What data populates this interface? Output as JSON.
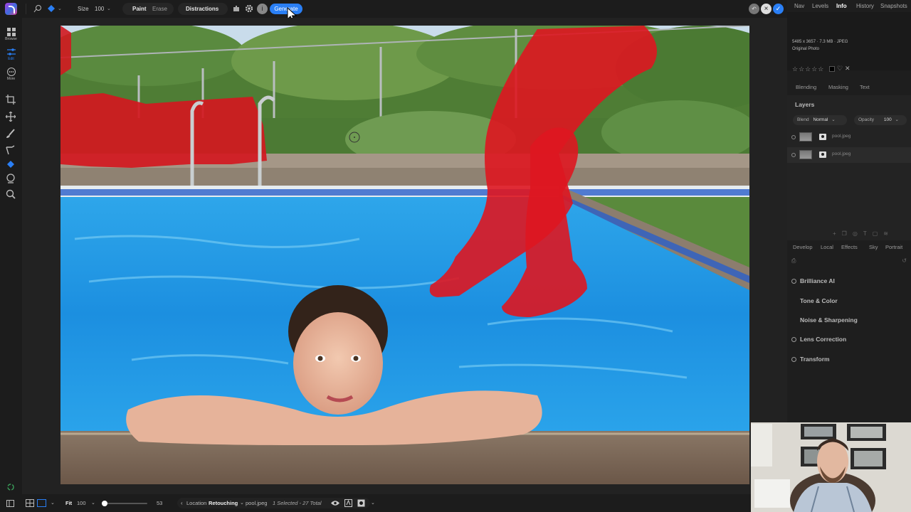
{
  "toolbar": {
    "size_label": "Size",
    "size_value": "100",
    "paint_label": "Paint",
    "erase_label": "Erase",
    "mode_label": "Distractions",
    "generate_label": "Generate",
    "info_glyph": "i"
  },
  "left_rail": {
    "items": [
      {
        "label": "Browse",
        "icon": "grid-icon"
      },
      {
        "label": "Edit",
        "icon": "sliders-icon"
      },
      {
        "label": "More",
        "icon": "more-icon"
      }
    ],
    "tools": [
      "crop-icon",
      "move-icon",
      "brush-icon",
      "clone-icon",
      "eraser-ai-icon",
      "stamp-icon",
      "zoom-icon"
    ]
  },
  "right_panel": {
    "tabs": [
      "Nav",
      "Levels",
      "Info",
      "History",
      "Snapshots"
    ],
    "active_tab": "Info",
    "info": {
      "dimensions": "5485 x 3657 · 7.3 MB · JPEG",
      "status": "Original Photo",
      "stars": "☆☆☆☆☆"
    },
    "sub_tabs": [
      "Blending",
      "Masking",
      "Text"
    ],
    "layers": {
      "title": "Layers",
      "blend_label": "Blend",
      "blend_value": "Normal",
      "opacity_label": "Opacity",
      "opacity_value": "100",
      "rows": [
        {
          "name": "pool.jpeg"
        },
        {
          "name": "pool.jpeg"
        }
      ]
    },
    "develop_tabs": [
      "Develop",
      "Local",
      "Effects",
      "Sky",
      "Portrait"
    ],
    "sections": [
      "Brilliance AI",
      "Tone & Color",
      "Noise & Sharpening",
      "Lens Correction",
      "Transform"
    ]
  },
  "bottom": {
    "fit_label": "Fit",
    "zoom_value": "100",
    "slider_value": 53,
    "slider_max": 100,
    "slider_readout": "53",
    "location_label": "Location",
    "location_value": "Retouching",
    "file_name": "pool.jpeg",
    "selection_status": "1 Selected - 27 Total"
  },
  "colors": {
    "accent": "#2a7ff5",
    "mask": "#e0101a"
  }
}
